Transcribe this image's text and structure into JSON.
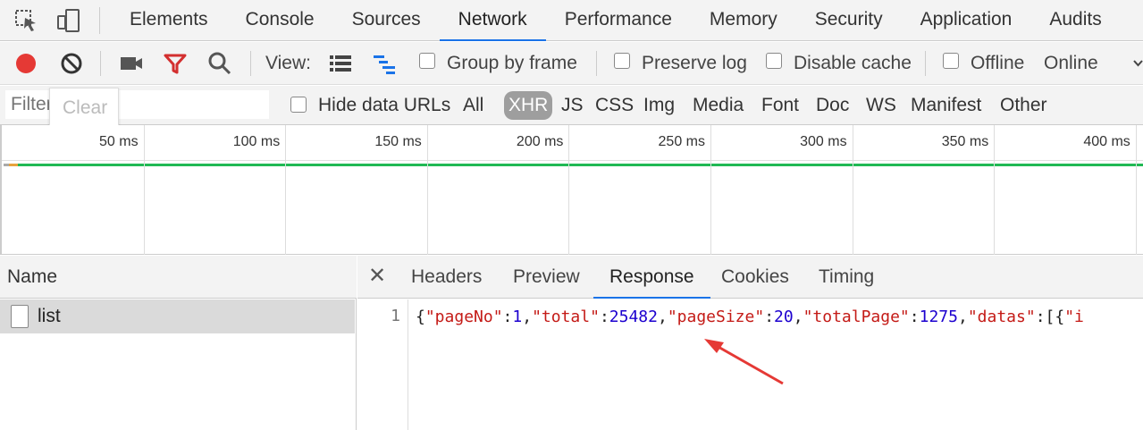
{
  "tabs": [
    "Elements",
    "Console",
    "Sources",
    "Network",
    "Performance",
    "Memory",
    "Security",
    "Application",
    "Audits"
  ],
  "active_tab": "Network",
  "toolbar": {
    "view_label": "View:",
    "group_by_frame": "Group by frame",
    "preserve_log": "Preserve log",
    "disable_cache": "Disable cache",
    "offline": "Offline",
    "throttle": "Online"
  },
  "filter": {
    "placeholder": "Filter",
    "clear": "Clear",
    "hide_data_urls": "Hide data URLs",
    "types": [
      "All",
      "XHR",
      "JS",
      "CSS",
      "Img",
      "Media",
      "Font",
      "Doc",
      "WS",
      "Manifest",
      "Other"
    ],
    "active_type": "XHR"
  },
  "timeline": {
    "ticks": [
      "50 ms",
      "100 ms",
      "150 ms",
      "200 ms",
      "250 ms",
      "300 ms",
      "350 ms",
      "400 ms"
    ]
  },
  "requests": {
    "header": "Name",
    "rows": [
      "list"
    ]
  },
  "detail": {
    "tabs": [
      "Headers",
      "Preview",
      "Response",
      "Cookies",
      "Timing"
    ],
    "active_tab": "Response",
    "line_number": "1",
    "response_tokens": [
      {
        "t": "p",
        "v": "{"
      },
      {
        "t": "k",
        "v": "\"pageNo\""
      },
      {
        "t": "p",
        "v": ":"
      },
      {
        "t": "n",
        "v": "1"
      },
      {
        "t": "p",
        "v": ","
      },
      {
        "t": "k",
        "v": "\"total\""
      },
      {
        "t": "p",
        "v": ":"
      },
      {
        "t": "n",
        "v": "25482"
      },
      {
        "t": "p",
        "v": ","
      },
      {
        "t": "k",
        "v": "\"pageSize\""
      },
      {
        "t": "p",
        "v": ":"
      },
      {
        "t": "n",
        "v": "20"
      },
      {
        "t": "p",
        "v": ","
      },
      {
        "t": "k",
        "v": "\"totalPage\""
      },
      {
        "t": "p",
        "v": ":"
      },
      {
        "t": "n",
        "v": "1275"
      },
      {
        "t": "p",
        "v": ","
      },
      {
        "t": "k",
        "v": "\"datas\""
      },
      {
        "t": "p",
        "v": ":[{"
      },
      {
        "t": "k",
        "v": "\"i"
      }
    ]
  },
  "colors": {
    "accent": "#1a73e8",
    "record": "#e53935",
    "filter_icon": "#d32f2f",
    "timeline_green": "#21b954",
    "annotation_arrow": "#e53935"
  }
}
